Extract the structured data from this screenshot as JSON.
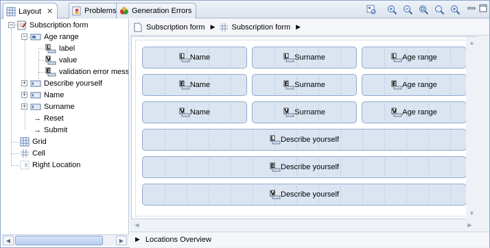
{
  "tabs": [
    {
      "label": "Layout",
      "icon": "layout-grid-icon",
      "active": true,
      "closable": true
    },
    {
      "label": "Problems",
      "icon": "problems-icon",
      "active": false
    },
    {
      "label": "Generation Errors",
      "icon": "generation-errors-icon",
      "active": false
    }
  ],
  "toolbar": {
    "icons": [
      "outline-icon",
      "zoom-in-icon",
      "zoom-out-icon",
      "zoom-fit-icon",
      "zoom-reset-icon",
      "zoom-selection-icon"
    ],
    "window_controls": [
      "minimize-icon",
      "maximize-icon"
    ]
  },
  "tree": {
    "items": [
      {
        "label": "Subscription form",
        "icon": "form-icon"
      },
      {
        "label": "Age range",
        "icon": "field-group-icon"
      },
      {
        "label": "label",
        "icon": "label-icon"
      },
      {
        "label": "value",
        "icon": "value-icon"
      },
      {
        "label": "validation error message",
        "icon": "error-message-icon"
      },
      {
        "label": "Describe yourself",
        "icon": "field-icon"
      },
      {
        "label": "Name",
        "icon": "field-icon"
      },
      {
        "label": "Surname",
        "icon": "field-icon"
      },
      {
        "label": "Reset",
        "icon": "arrow-right-icon"
      },
      {
        "label": "Submit",
        "icon": "arrow-right-icon"
      },
      {
        "label": "Grid",
        "icon": "grid-icon"
      },
      {
        "label": "Cell",
        "icon": "cell-icon"
      },
      {
        "label": "Right Location",
        "icon": "location-icon"
      }
    ]
  },
  "breadcrumb": {
    "items": [
      {
        "label": "Subscription form",
        "icon": "page-icon"
      },
      {
        "label": "Subscription form",
        "icon": "grid-icon"
      }
    ]
  },
  "canvas": {
    "rows": [
      {
        "cells": [
          {
            "label": "Name",
            "icon": "label-icon"
          },
          {
            "label": "Surname",
            "icon": "label-icon"
          },
          {
            "label": "Age range",
            "icon": "label-icon"
          }
        ]
      },
      {
        "cells": [
          {
            "label": "Name",
            "icon": "error-message-icon"
          },
          {
            "label": "Surname",
            "icon": "error-message-icon"
          },
          {
            "label": "Age range",
            "icon": "error-message-icon"
          }
        ]
      },
      {
        "cells": [
          {
            "label": "Name",
            "icon": "value-icon"
          },
          {
            "label": "Surname",
            "icon": "value-icon"
          },
          {
            "label": "Age range",
            "icon": "value-icon"
          }
        ]
      },
      {
        "cells": [
          {
            "label": "Describe yourself",
            "icon": "label-icon"
          }
        ]
      },
      {
        "cells": [
          {
            "label": "Describe yourself",
            "icon": "error-message-icon"
          }
        ]
      },
      {
        "cells": [
          {
            "label": "Describe yourself",
            "icon": "value-icon"
          }
        ]
      }
    ]
  },
  "overview": {
    "label": "Locations Overview"
  },
  "colors": {
    "cell_fill": "#dbe5f2",
    "cell_border": "#8fa9cd",
    "accent": "#2a5fb0"
  }
}
